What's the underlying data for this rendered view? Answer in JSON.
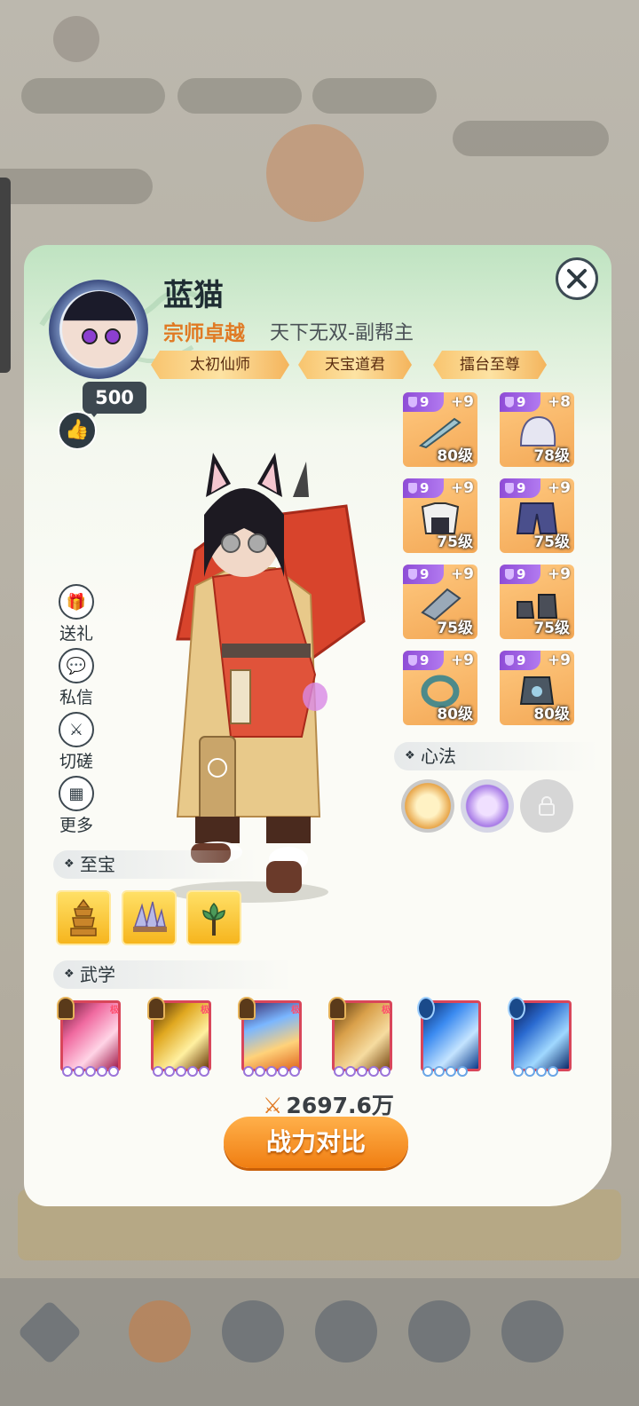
{
  "player": {
    "name": "蓝猫",
    "rank_title": "宗师卓越",
    "guild_title": "天下无双-副帮主",
    "badges": [
      "太初仙师",
      "天宝道君",
      "擂台至尊"
    ],
    "likes": "500"
  },
  "equipment": [
    {
      "gem": "9",
      "plus": "+9",
      "level": "80级",
      "icon": "sword-icon"
    },
    {
      "gem": "9",
      "plus": "+8",
      "level": "78级",
      "icon": "helmet-icon"
    },
    {
      "gem": "9",
      "plus": "+9",
      "level": "75级",
      "icon": "robe-icon"
    },
    {
      "gem": "9",
      "plus": "+9",
      "level": "75级",
      "icon": "trousers-icon"
    },
    {
      "gem": "9",
      "plus": "+9",
      "level": "75级",
      "icon": "bracer-icon"
    },
    {
      "gem": "9",
      "plus": "+9",
      "level": "75级",
      "icon": "boots-icon"
    },
    {
      "gem": "9",
      "plus": "+9",
      "level": "80级",
      "icon": "ring-icon"
    },
    {
      "gem": "9",
      "plus": "+9",
      "level": "80级",
      "icon": "amulet-icon"
    }
  ],
  "side_actions": [
    "送礼",
    "私信",
    "切磋",
    "更多"
  ],
  "sections": {
    "xinfa": "心法",
    "zhibao": "至宝",
    "wuxue": "武学"
  },
  "xinfa_icons": [
    "golden-meditation-icon",
    "purple-meditation-icon",
    "locked-icon"
  ],
  "treasures": [
    "pagoda-icon",
    "crystal-icon",
    "lotus-icon"
  ],
  "skills": [
    {
      "icon": "pink-slash-icon",
      "mark": "极"
    },
    {
      "icon": "golden-strike-icon",
      "mark": "极"
    },
    {
      "icon": "comet-icon",
      "mark": "极"
    },
    {
      "icon": "dancing-figures-icon",
      "mark": "极"
    },
    {
      "icon": "blue-sword-icon",
      "mark": ""
    },
    {
      "icon": "lightning-icon",
      "mark": ""
    }
  ],
  "combat_power": "2697.6万",
  "compare_button": "战力对比",
  "colors": {
    "accent_orange": "#f07e12",
    "gem_purple": "#8e4cd6",
    "title_orange": "#e07a24"
  }
}
